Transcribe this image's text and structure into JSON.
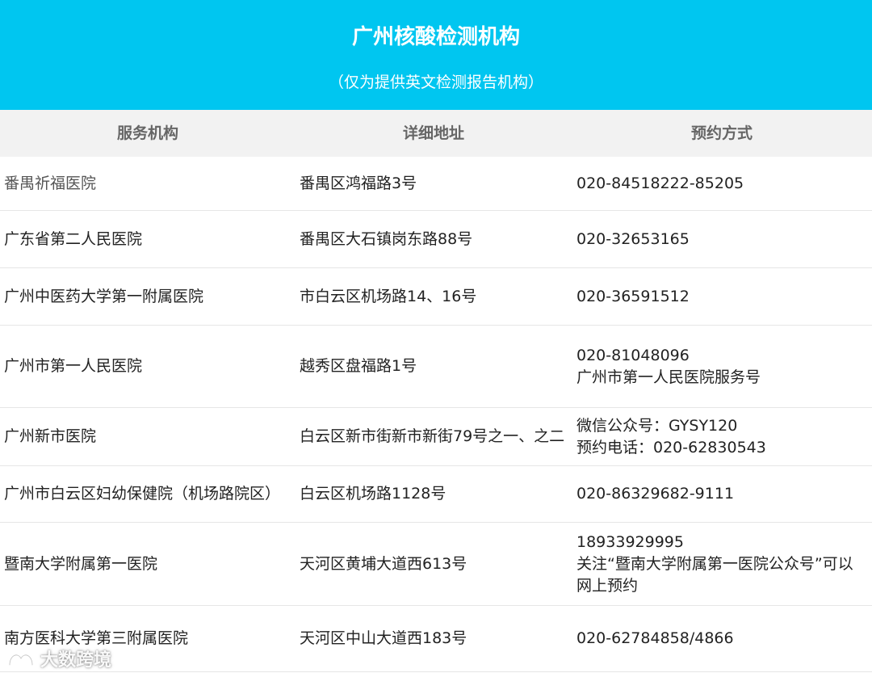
{
  "banner": {
    "title": "广州核酸检测机构",
    "subtitle": "（仅为提供英文检测报告机构）",
    "color": "#00c6f0"
  },
  "table": {
    "headers": [
      "服务机构",
      "详细地址",
      "预约方式"
    ],
    "rows": [
      {
        "name": "番禺祈福医院",
        "address": "番禺区鸿福路3号",
        "booking": "020-84518222-85205"
      },
      {
        "name": "广东省第二人民医院",
        "address": "番禺区大石镇岗东路88号",
        "booking": "020-32653165"
      },
      {
        "name": "广州中医药大学第一附属医院",
        "address": "市白云区机场路14、16号",
        "booking": "020-36591512"
      },
      {
        "name": "广州市第一人民医院",
        "address": "越秀区盘福路1号",
        "booking": "020-81048096\n广州市第一人民医院服务号"
      },
      {
        "name": "广州新市医院",
        "address": "白云区新市街新市新街79号之一、之二",
        "booking": "微信公众号：GYSY120\n预约电话：020-62830543"
      },
      {
        "name": "广州市白云区妇幼保健院（机场路院区）",
        "address": "白云区机场路1128号",
        "booking": "020-86329682-9111"
      },
      {
        "name": "暨南大学附属第一医院",
        "address": "天河区黄埔大道西613号",
        "booking": "18933929995\n关注“暨南大学附属第一医院公众号”可以网上预约"
      },
      {
        "name": "南方医科大学第三附属医院",
        "address": "天河区中山大道西183号",
        "booking": "020-62784858/4866"
      }
    ]
  },
  "watermark": {
    "text": "大数跨境"
  }
}
